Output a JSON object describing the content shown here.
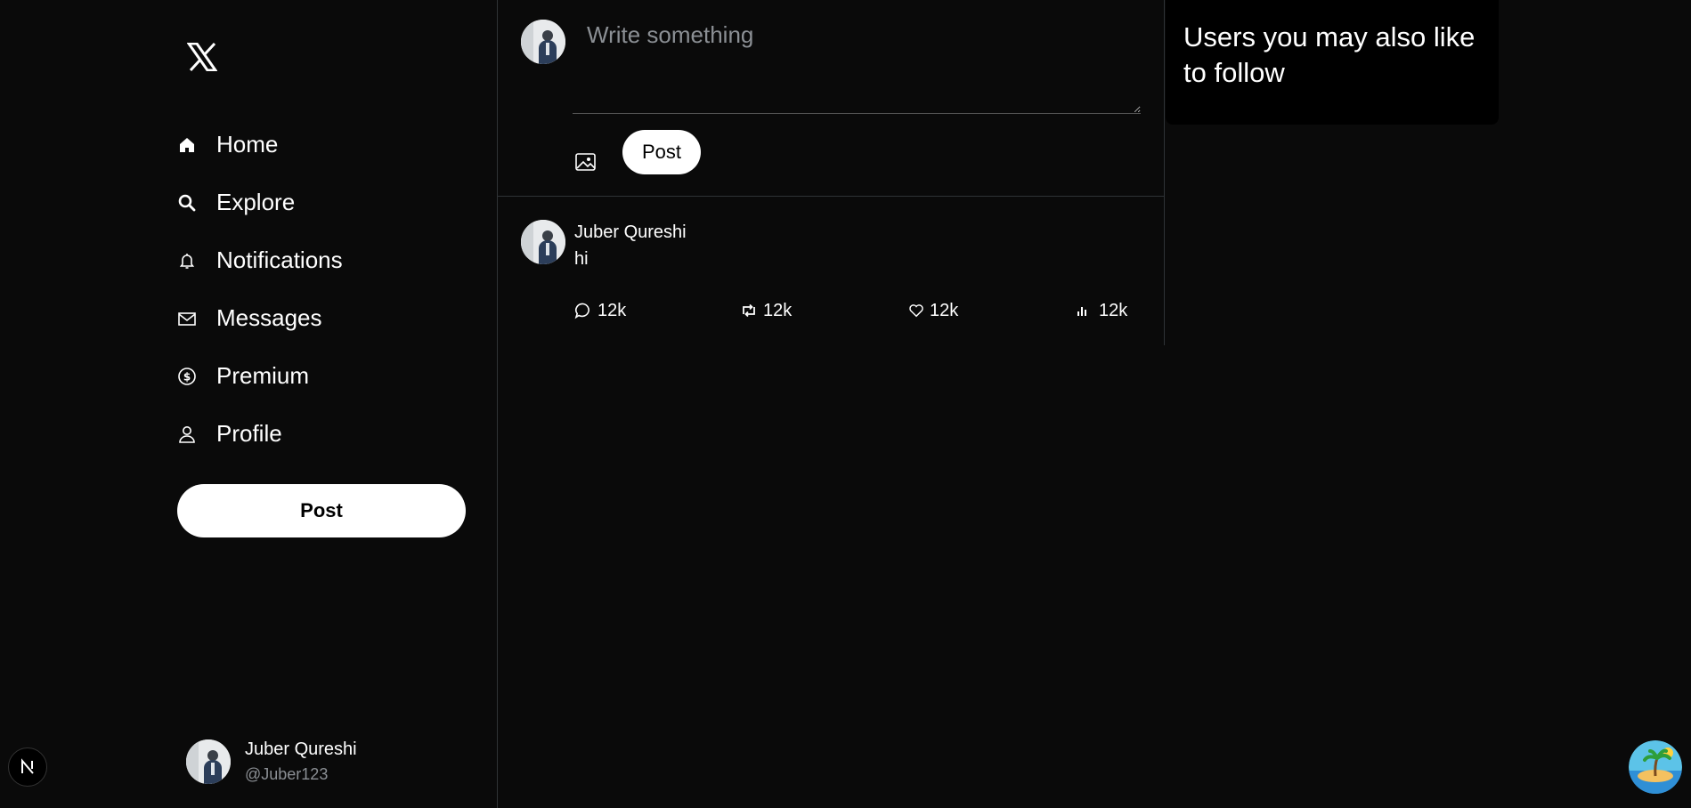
{
  "app": {
    "logo_icon": "x-logo-icon"
  },
  "sidebar": {
    "nav": [
      {
        "label": "Home",
        "icon": "home-icon"
      },
      {
        "label": "Explore",
        "icon": "search-icon"
      },
      {
        "label": "Notifications",
        "icon": "bell-icon"
      },
      {
        "label": "Messages",
        "icon": "mail-icon"
      },
      {
        "label": "Premium",
        "icon": "dollar-circle-icon"
      },
      {
        "label": "Profile",
        "icon": "user-icon"
      }
    ],
    "post_button": "Post",
    "account": {
      "name": "Juber Qureshi",
      "handle": "@Juber123"
    }
  },
  "compose": {
    "placeholder": "Write something",
    "post_button": "Post"
  },
  "feed": {
    "tweets": [
      {
        "author": "Juber Qureshi",
        "text": "hi",
        "replies": "12k",
        "retweets": "12k",
        "likes": "12k",
        "views": "12k"
      }
    ]
  },
  "right_panel": {
    "title": "Users you may also like to follow"
  },
  "colors": {
    "background": "#0a0a0a",
    "border": "#2f3336",
    "muted_text": "#8b8f94",
    "button_bg": "#ffffff"
  }
}
